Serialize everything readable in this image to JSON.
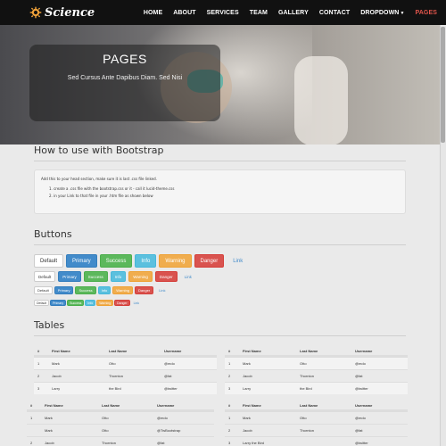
{
  "nav": {
    "brand": "Science",
    "items": [
      "HOME",
      "ABOUT",
      "SERVICES",
      "TEAM",
      "GALLERY",
      "CONTACT",
      "DROPDOWN",
      "PAGES"
    ],
    "active": "PAGES",
    "accent_color": "#e0554b",
    "logo_icon": "gear-icon",
    "logo_color": "#f0a23a"
  },
  "hero": {
    "title": "PAGES",
    "subtitle": "Sed Cursus Ante Dapibus Diam. Sed Nisi"
  },
  "howto": {
    "title": "How to use with Bootstrap",
    "intro": "Add this to your head section, make sure it is last .css file linked.",
    "steps": [
      "1. create a .css file with the bootstrap.css or it - call it lucid-theme.css",
      "2. in your Link to that file in your .htm file as shown below"
    ]
  },
  "buttons": {
    "title": "Buttons",
    "labels": [
      "Default",
      "Primary",
      "Success",
      "Info",
      "Warning",
      "Danger",
      "Link"
    ],
    "colors": {
      "primary": "#428bca",
      "success": "#5cb85c",
      "info": "#5bc0de",
      "warning": "#f0ad4e",
      "danger": "#d9534f"
    }
  },
  "tables": {
    "title": "Tables",
    "headers": [
      "#",
      "First Name",
      "Last Name",
      "Username"
    ],
    "t1": [
      [
        "1",
        "Mark",
        "Otto",
        "@mdo"
      ],
      [
        "2",
        "Jacob",
        "Thornton",
        "@fat"
      ],
      [
        "3",
        "Larry",
        "the Bird",
        "@twitter"
      ]
    ],
    "t2": [
      [
        "1",
        "Mark",
        "Otto",
        "@mdo"
      ],
      [
        "2",
        "Jacob",
        "Thornton",
        "@fat"
      ],
      [
        "3",
        "Larry",
        "the Bird",
        "@twitter"
      ]
    ],
    "t3": [
      [
        "1",
        "Mark",
        "Otto",
        "@mdo"
      ],
      [
        "",
        "Mark",
        "Otto",
        "@TwBootstrap"
      ],
      [
        "2",
        "Jacob",
        "Thornton",
        "@fat"
      ]
    ],
    "t4": [
      [
        "1",
        "Mark",
        "Otto",
        "@mdo"
      ],
      [
        "2",
        "Jacob",
        "Thornton",
        "@fat"
      ],
      [
        "3",
        "Larry the Bird",
        "",
        "@twitter"
      ]
    ]
  }
}
